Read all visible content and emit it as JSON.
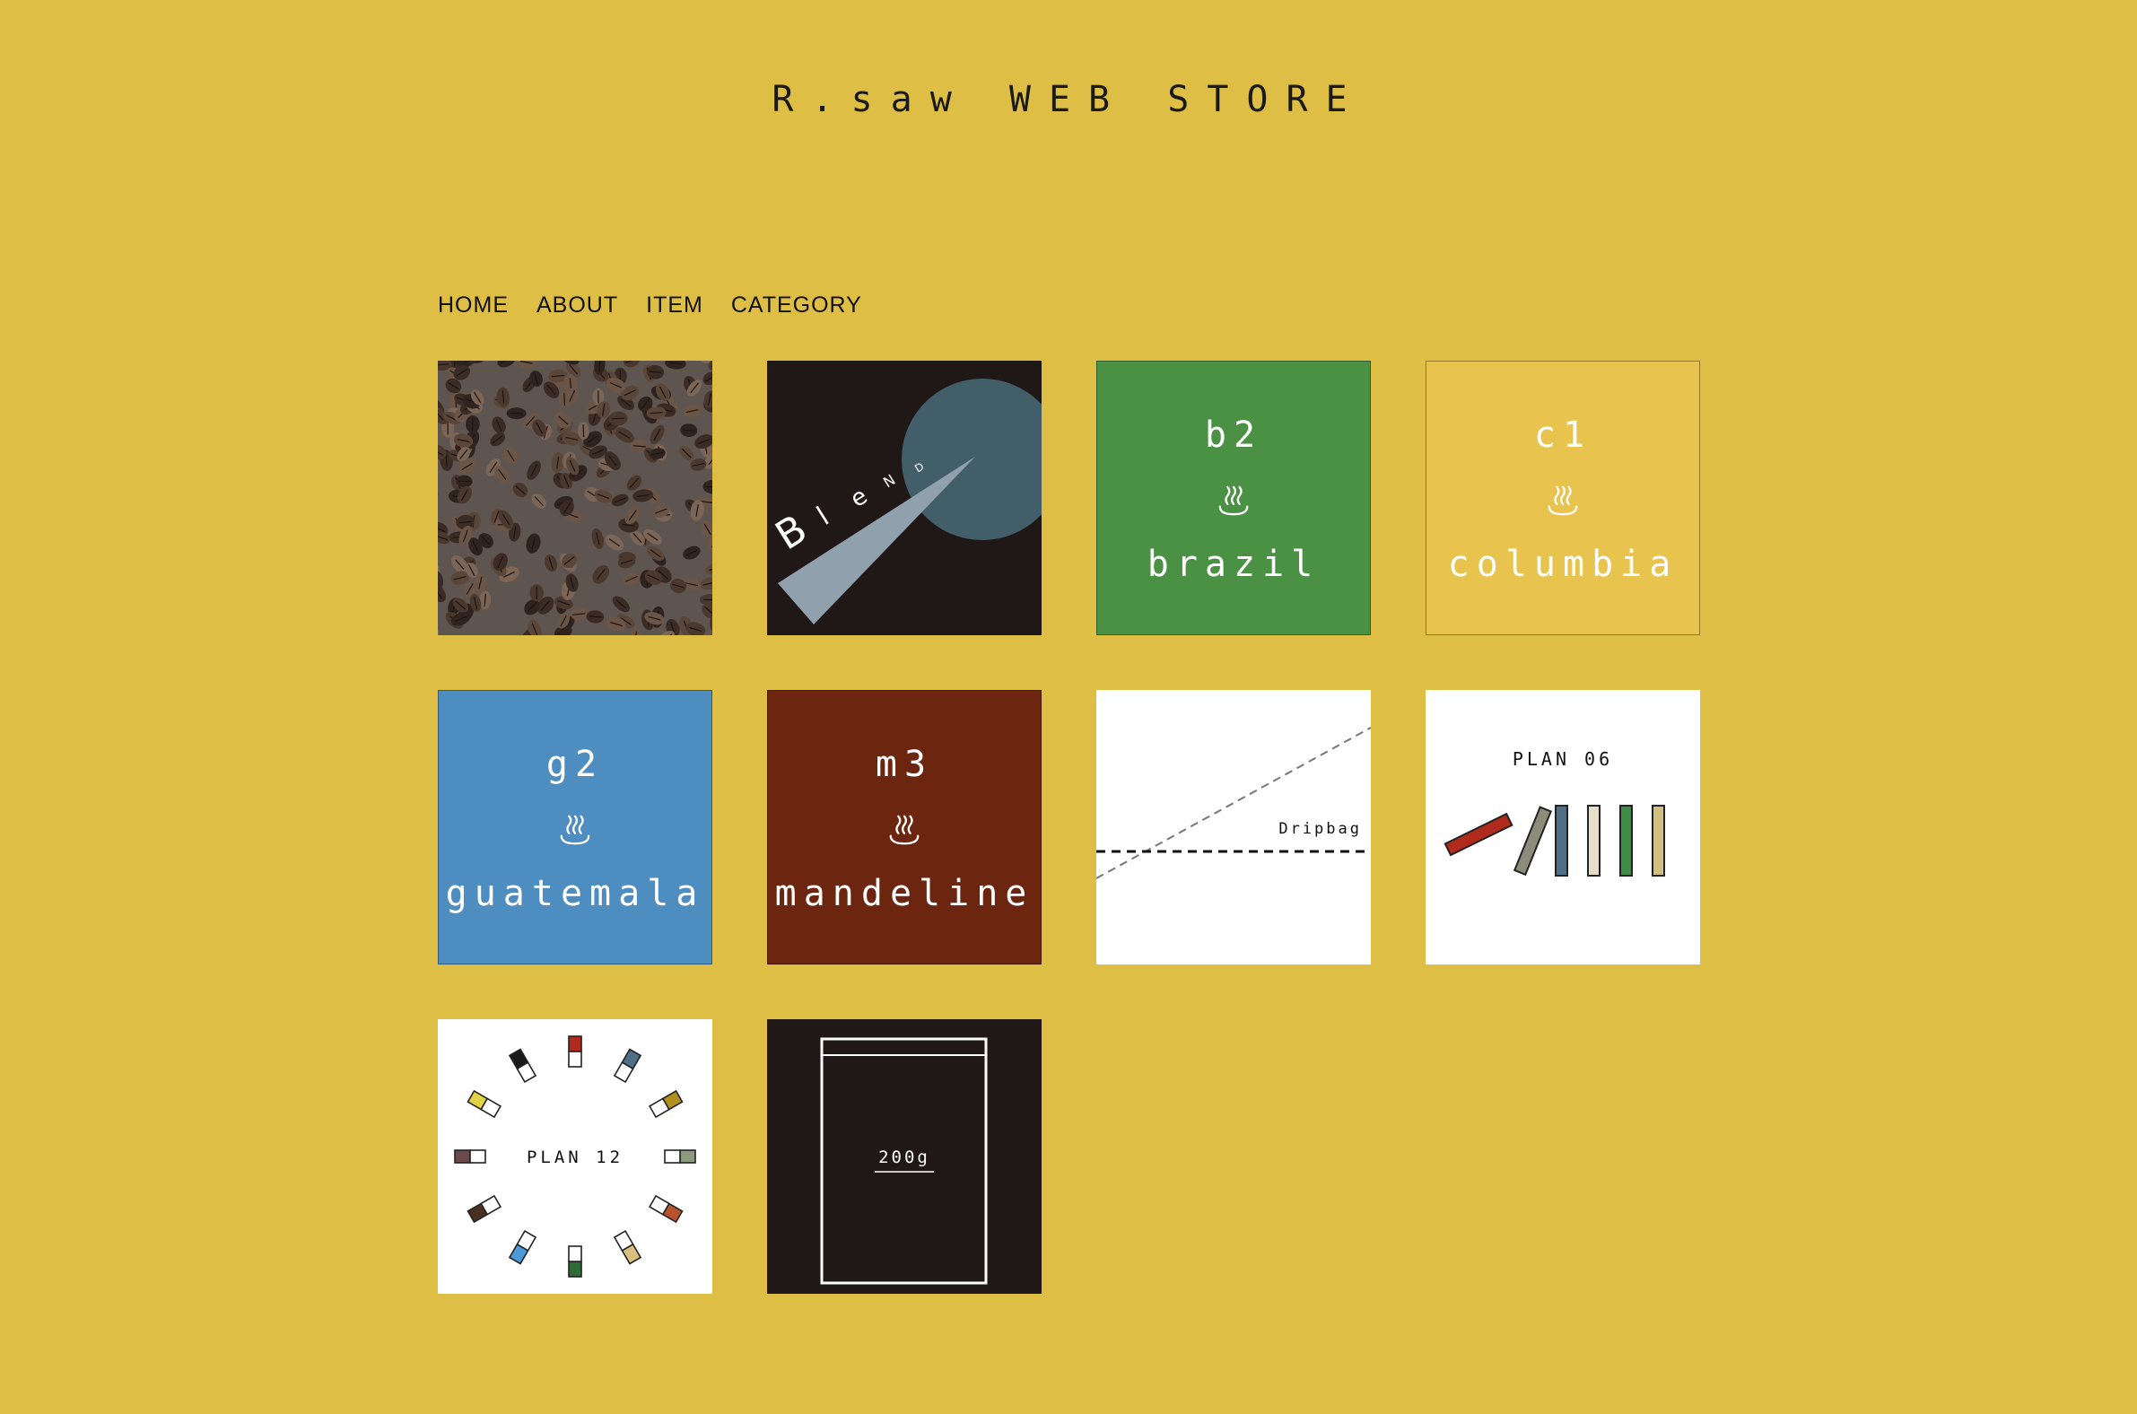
{
  "site": {
    "title": "R.saw WEB STORE"
  },
  "nav": {
    "items": [
      {
        "label": "HOME"
      },
      {
        "label": "ABOUT"
      },
      {
        "label": "ITEM"
      },
      {
        "label": "CATEGORY"
      }
    ]
  },
  "products": {
    "beans": {
      "icon": "coffee-beans-photo"
    },
    "blend": {
      "label": "BleND",
      "letters": [
        "B",
        "l",
        "e",
        "N",
        "D"
      ]
    },
    "brazil": {
      "code": "b2",
      "name": "brazil",
      "icon": "hot-springs-icon",
      "color": "#4a9144"
    },
    "columbia": {
      "code": "c1",
      "name": "columbia",
      "icon": "hot-springs-icon",
      "color": "#e8c44f"
    },
    "guatemala": {
      "code": "g2",
      "name": "guatemala",
      "icon": "hot-springs-icon",
      "color": "#4e8dbf"
    },
    "mandeline": {
      "code": "m3",
      "name": "mandeline",
      "icon": "hot-springs-icon",
      "color": "#6c260f"
    },
    "dripbag": {
      "label": "Dripbag"
    },
    "plan06": {
      "label": "PLAN 06"
    },
    "plan12": {
      "label": "PLAN 12"
    },
    "bag200": {
      "label": "200g"
    }
  },
  "colors": {
    "background": "#dfbe45",
    "dark": "#201717",
    "blend_circle": "#425e68",
    "blend_triangle": "#90a0ad"
  }
}
